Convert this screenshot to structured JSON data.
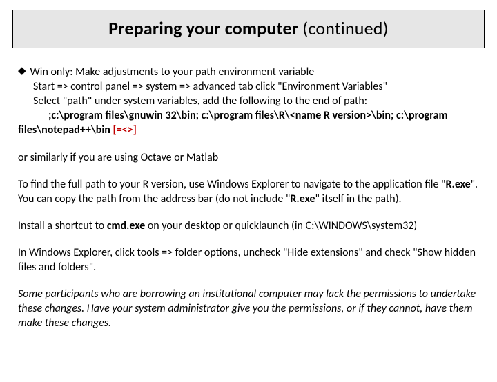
{
  "title": {
    "boldPart": "Preparing your computer ",
    "plainPart": "(continued)"
  },
  "b1": {
    "lead": "Win only: Make adjustments to your path environment variable",
    "nav": "Start => control panel => system => advanced tab  click \"Environment Variables\"",
    "sel": "Select \"path\" under system variables, add the following to the end of path:",
    "path1": ";c:\\program files\\gnuwin 32\\bin; c:\\program files\\R\\<name R version>\\bin; c:\\program",
    "path2a": "files\\notepad++\\bin ",
    "path2b": "[=<>]"
  },
  "p_octave": "or similarly if you are using Octave or Matlab",
  "p_rpath_a": "To find the full path to your R version, use Windows Explorer to navigate to the application file \"",
  "rexe1": "R.exe",
  "p_rpath_b": "\". You can copy the path from the address bar (do not include \"",
  "rexe2": "R.exe",
  "p_rpath_c": "\" itself in the path).",
  "p_shortcut_a": "Install a shortcut to ",
  "cmdexe": "cmd.exe",
  "p_shortcut_b": " on your desktop or quicklaunch (in C:\\WINDOWS\\system32)",
  "p_explorer": "In Windows Explorer, click tools => folder options, uncheck \"Hide extensions\" and check \"Show hidden files and folders\".",
  "p_italic": "Some participants who are borrowing an institutional computer may lack the permissions to undertake these changes. Have your system administrator give you the permissions, or if they cannot, have them make these changes."
}
